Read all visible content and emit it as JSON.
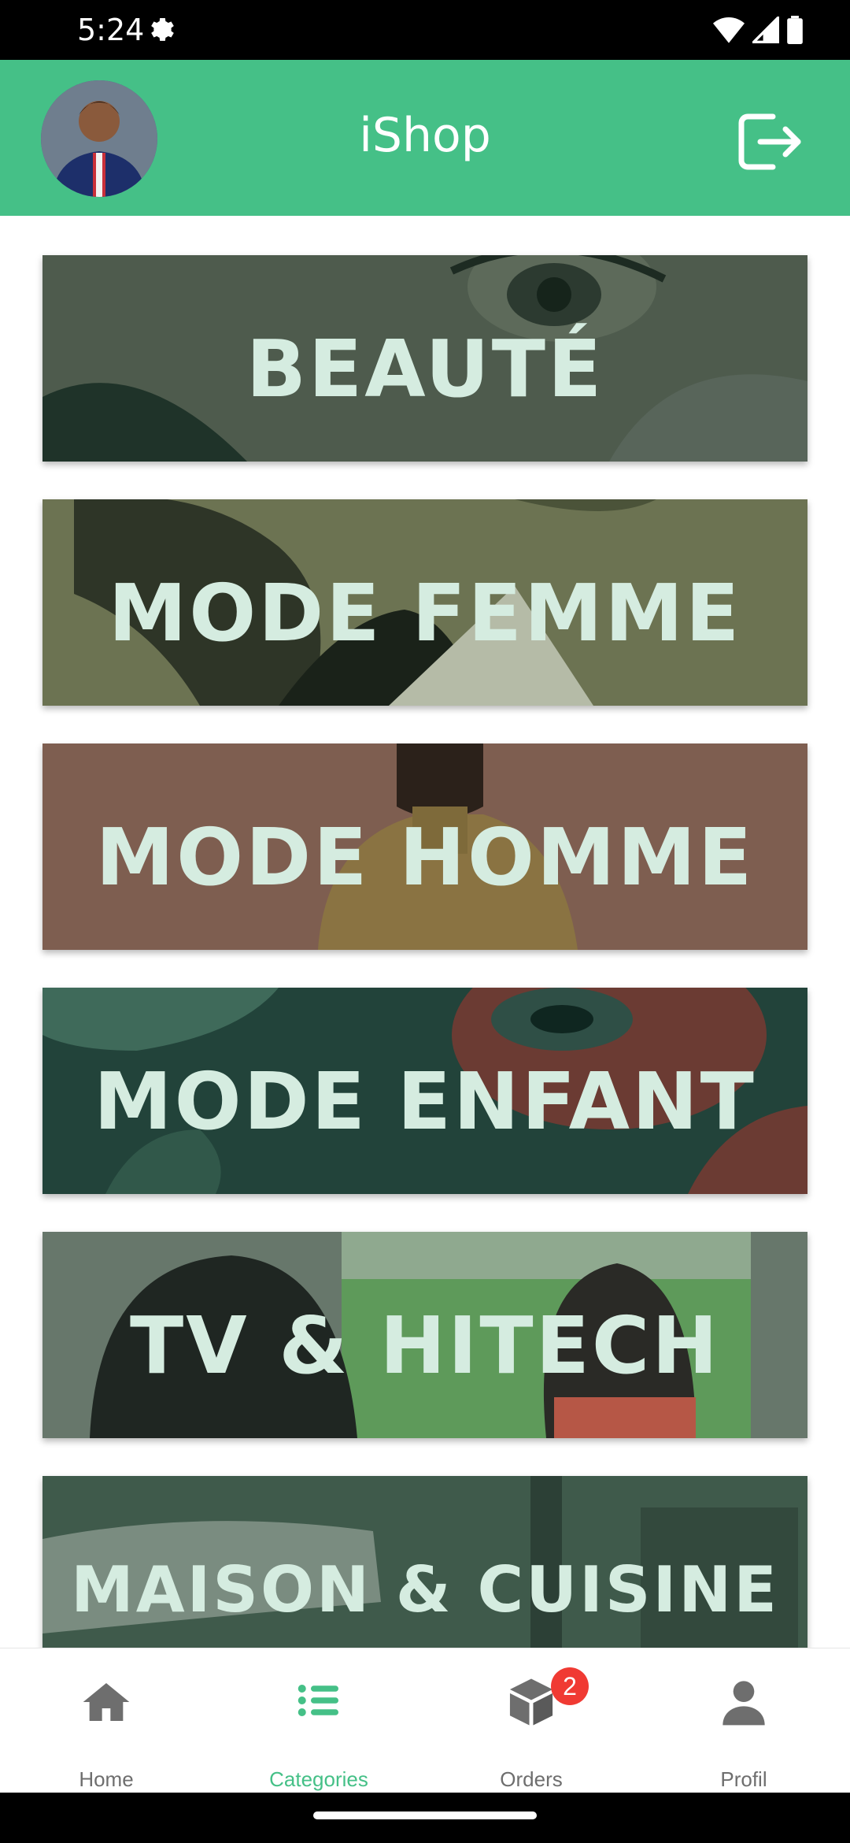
{
  "status_bar": {
    "time": "5:24"
  },
  "app_bar": {
    "title": "iShop"
  },
  "categories": [
    {
      "label": "BEAUTÉ",
      "bg": "#4c5a4b"
    },
    {
      "label": "MODE FEMME",
      "bg": "#6a7150"
    },
    {
      "label": "MODE HOMME",
      "bg": "#7d5d4f"
    },
    {
      "label": "MODE ENFANT",
      "bg": "#214237"
    },
    {
      "label": "TV & HITECH",
      "bg": "#627468"
    },
    {
      "label": "MAISON & CUISINE",
      "bg": "#3d5849"
    }
  ],
  "bottom_nav": {
    "items": [
      {
        "label": "Home",
        "icon": "home-icon"
      },
      {
        "label": "Categories",
        "icon": "list-icon",
        "active": true
      },
      {
        "label": "Orders",
        "icon": "box-icon",
        "badge": "2"
      },
      {
        "label": "Profil",
        "icon": "person-icon"
      }
    ]
  },
  "colors": {
    "primary": "#45c087",
    "badge": "#f03a33",
    "inactive": "#6e6e6e"
  }
}
